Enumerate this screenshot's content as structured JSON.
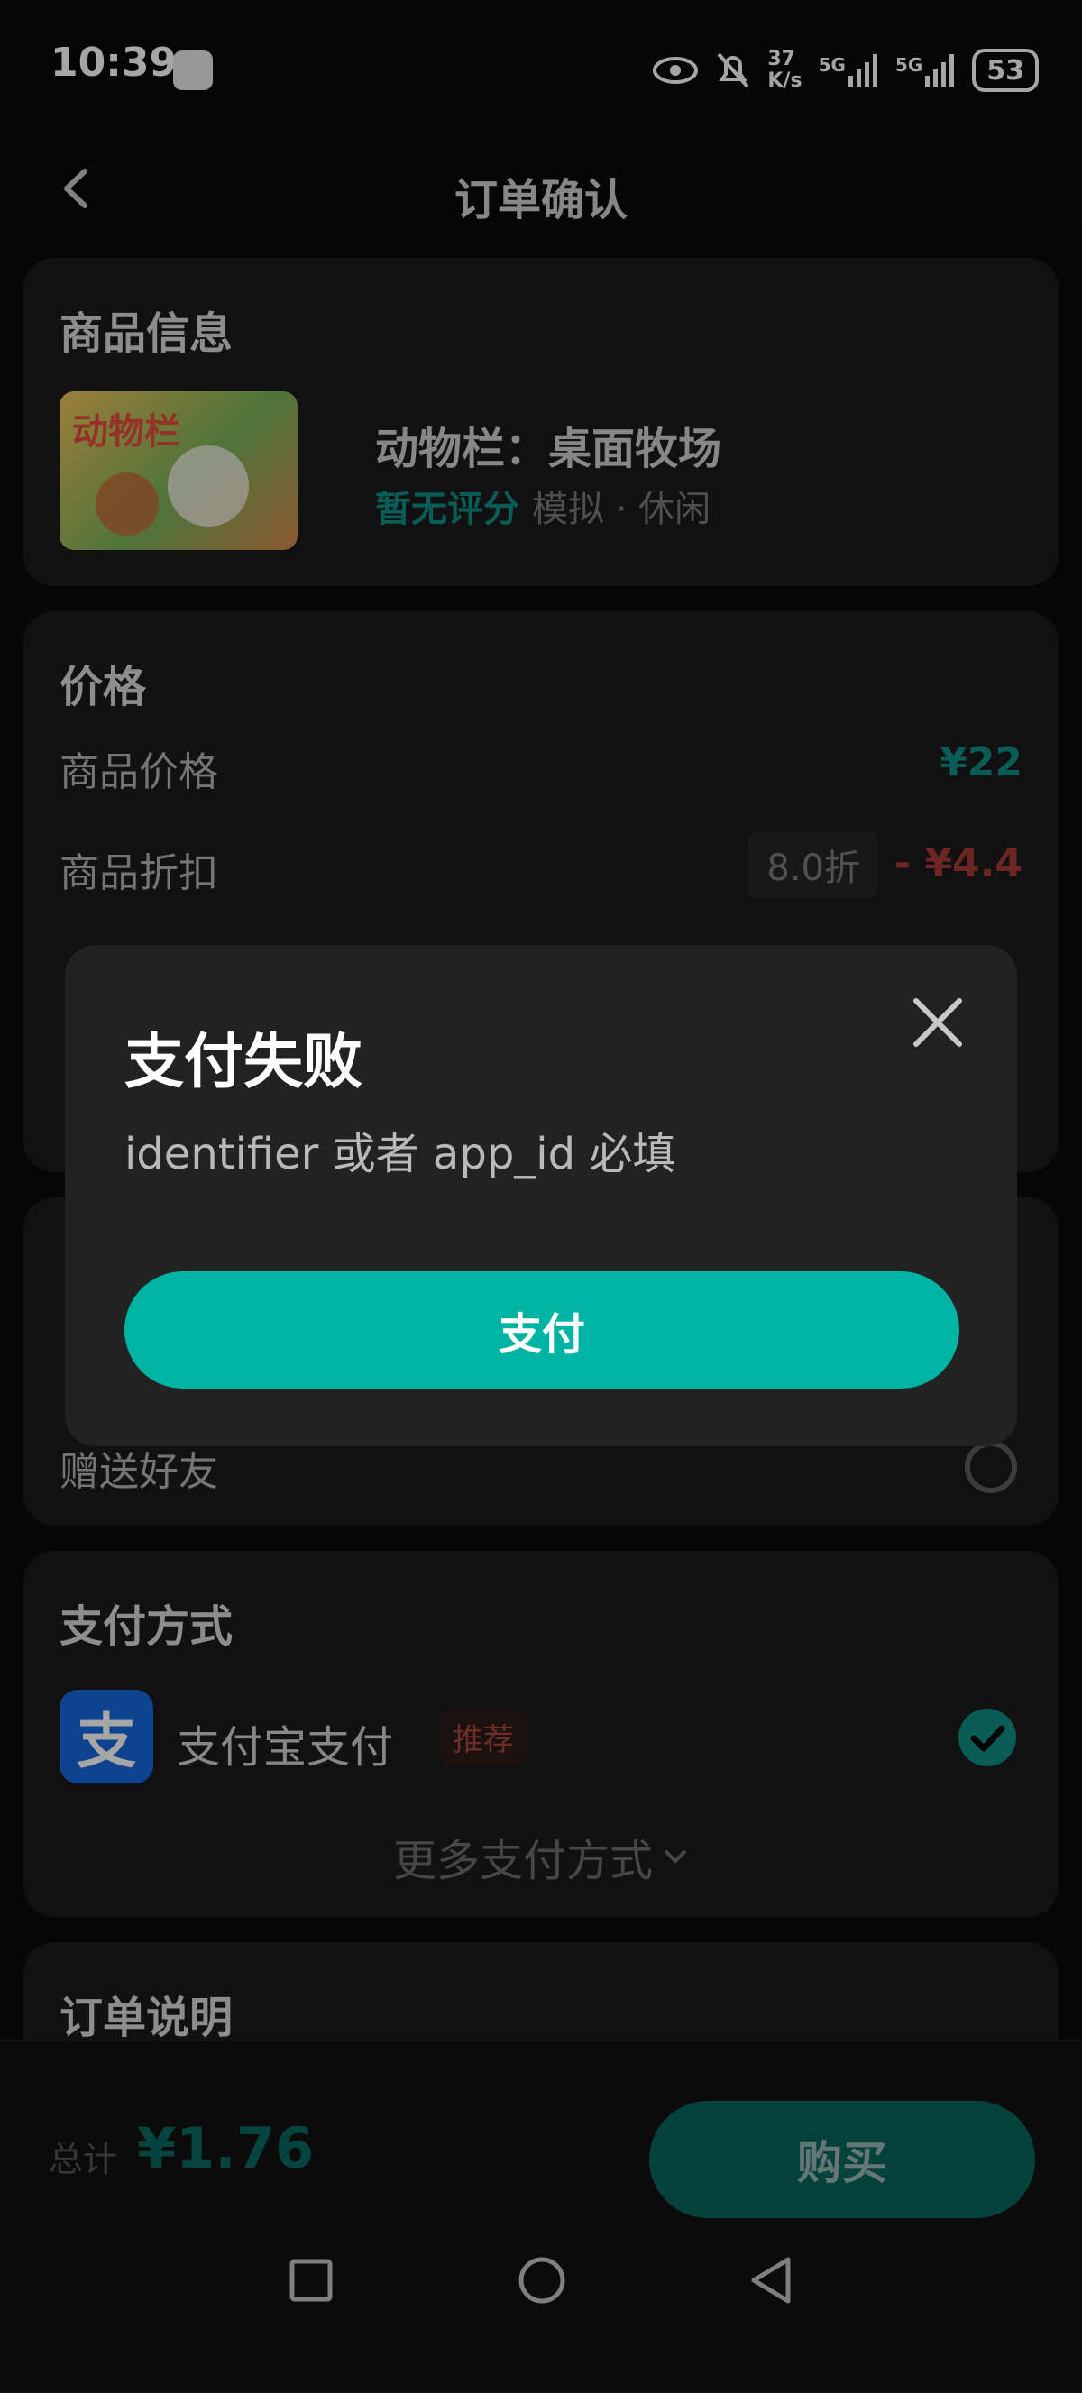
{
  "status": {
    "time": "10:39",
    "net_speed_top": "37",
    "net_speed_bottom": "K/s",
    "sig1": "5G",
    "sig2": "5G",
    "battery": "53"
  },
  "header": {
    "title": "订单确认"
  },
  "product": {
    "section_title": "商品信息",
    "name": "动物栏：桌面牧场",
    "rating": "暂无评分",
    "tags": "模拟 · 休闲",
    "thumb_text": "动物栏"
  },
  "price": {
    "section_title": "价格",
    "item_price_label": "商品价格",
    "item_price_value": "¥22",
    "discount_label": "商品折扣",
    "discount_badge": "8.0折",
    "discount_value": "- ¥4.4"
  },
  "gift": {
    "label": "赠送好友"
  },
  "payment": {
    "section_title": "支付方式",
    "alipay_icon_text": "支",
    "alipay_label": "支付宝支付",
    "recommend_badge": "推荐",
    "more_label": "更多支付方式"
  },
  "order_notes": {
    "section_title": "订单说明"
  },
  "footer": {
    "total_label": "总计",
    "total_value": "¥1.76",
    "buy_label": "购买"
  },
  "modal": {
    "title": "支付失败",
    "message": "identifier 或者 app_id 必填",
    "pay_label": "支付"
  },
  "colors": {
    "accent": "#00b4a3",
    "price_green": "#0f8f85",
    "discount_red": "#a83c35"
  }
}
